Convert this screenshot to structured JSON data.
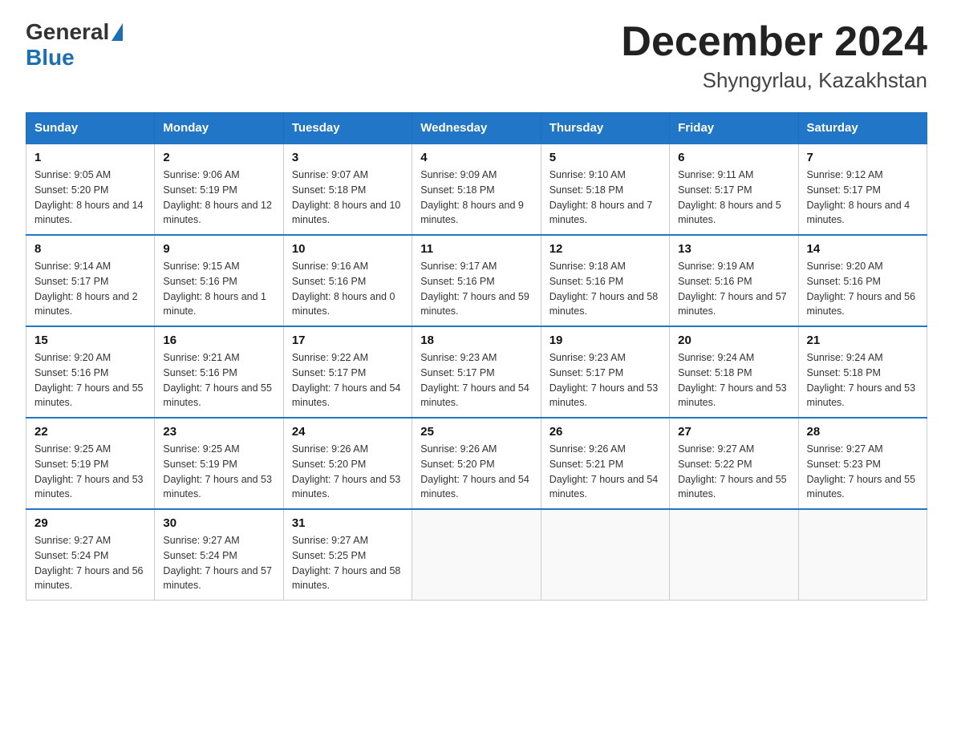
{
  "logo": {
    "general": "General",
    "blue": "Blue"
  },
  "title": "December 2024",
  "subtitle": "Shyngyrlau, Kazakhstan",
  "days_of_week": [
    "Sunday",
    "Monday",
    "Tuesday",
    "Wednesday",
    "Thursday",
    "Friday",
    "Saturday"
  ],
  "weeks": [
    [
      {
        "day": "1",
        "sunrise": "9:05 AM",
        "sunset": "5:20 PM",
        "daylight": "8 hours and 14 minutes."
      },
      {
        "day": "2",
        "sunrise": "9:06 AM",
        "sunset": "5:19 PM",
        "daylight": "8 hours and 12 minutes."
      },
      {
        "day": "3",
        "sunrise": "9:07 AM",
        "sunset": "5:18 PM",
        "daylight": "8 hours and 10 minutes."
      },
      {
        "day": "4",
        "sunrise": "9:09 AM",
        "sunset": "5:18 PM",
        "daylight": "8 hours and 9 minutes."
      },
      {
        "day": "5",
        "sunrise": "9:10 AM",
        "sunset": "5:18 PM",
        "daylight": "8 hours and 7 minutes."
      },
      {
        "day": "6",
        "sunrise": "9:11 AM",
        "sunset": "5:17 PM",
        "daylight": "8 hours and 5 minutes."
      },
      {
        "day": "7",
        "sunrise": "9:12 AM",
        "sunset": "5:17 PM",
        "daylight": "8 hours and 4 minutes."
      }
    ],
    [
      {
        "day": "8",
        "sunrise": "9:14 AM",
        "sunset": "5:17 PM",
        "daylight": "8 hours and 2 minutes."
      },
      {
        "day": "9",
        "sunrise": "9:15 AM",
        "sunset": "5:16 PM",
        "daylight": "8 hours and 1 minute."
      },
      {
        "day": "10",
        "sunrise": "9:16 AM",
        "sunset": "5:16 PM",
        "daylight": "8 hours and 0 minutes."
      },
      {
        "day": "11",
        "sunrise": "9:17 AM",
        "sunset": "5:16 PM",
        "daylight": "7 hours and 59 minutes."
      },
      {
        "day": "12",
        "sunrise": "9:18 AM",
        "sunset": "5:16 PM",
        "daylight": "7 hours and 58 minutes."
      },
      {
        "day": "13",
        "sunrise": "9:19 AM",
        "sunset": "5:16 PM",
        "daylight": "7 hours and 57 minutes."
      },
      {
        "day": "14",
        "sunrise": "9:20 AM",
        "sunset": "5:16 PM",
        "daylight": "7 hours and 56 minutes."
      }
    ],
    [
      {
        "day": "15",
        "sunrise": "9:20 AM",
        "sunset": "5:16 PM",
        "daylight": "7 hours and 55 minutes."
      },
      {
        "day": "16",
        "sunrise": "9:21 AM",
        "sunset": "5:16 PM",
        "daylight": "7 hours and 55 minutes."
      },
      {
        "day": "17",
        "sunrise": "9:22 AM",
        "sunset": "5:17 PM",
        "daylight": "7 hours and 54 minutes."
      },
      {
        "day": "18",
        "sunrise": "9:23 AM",
        "sunset": "5:17 PM",
        "daylight": "7 hours and 54 minutes."
      },
      {
        "day": "19",
        "sunrise": "9:23 AM",
        "sunset": "5:17 PM",
        "daylight": "7 hours and 53 minutes."
      },
      {
        "day": "20",
        "sunrise": "9:24 AM",
        "sunset": "5:18 PM",
        "daylight": "7 hours and 53 minutes."
      },
      {
        "day": "21",
        "sunrise": "9:24 AM",
        "sunset": "5:18 PM",
        "daylight": "7 hours and 53 minutes."
      }
    ],
    [
      {
        "day": "22",
        "sunrise": "9:25 AM",
        "sunset": "5:19 PM",
        "daylight": "7 hours and 53 minutes."
      },
      {
        "day": "23",
        "sunrise": "9:25 AM",
        "sunset": "5:19 PM",
        "daylight": "7 hours and 53 minutes."
      },
      {
        "day": "24",
        "sunrise": "9:26 AM",
        "sunset": "5:20 PM",
        "daylight": "7 hours and 53 minutes."
      },
      {
        "day": "25",
        "sunrise": "9:26 AM",
        "sunset": "5:20 PM",
        "daylight": "7 hours and 54 minutes."
      },
      {
        "day": "26",
        "sunrise": "9:26 AM",
        "sunset": "5:21 PM",
        "daylight": "7 hours and 54 minutes."
      },
      {
        "day": "27",
        "sunrise": "9:27 AM",
        "sunset": "5:22 PM",
        "daylight": "7 hours and 55 minutes."
      },
      {
        "day": "28",
        "sunrise": "9:27 AM",
        "sunset": "5:23 PM",
        "daylight": "7 hours and 55 minutes."
      }
    ],
    [
      {
        "day": "29",
        "sunrise": "9:27 AM",
        "sunset": "5:24 PM",
        "daylight": "7 hours and 56 minutes."
      },
      {
        "day": "30",
        "sunrise": "9:27 AM",
        "sunset": "5:24 PM",
        "daylight": "7 hours and 57 minutes."
      },
      {
        "day": "31",
        "sunrise": "9:27 AM",
        "sunset": "5:25 PM",
        "daylight": "7 hours and 58 minutes."
      },
      null,
      null,
      null,
      null
    ]
  ],
  "labels": {
    "sunrise": "Sunrise:",
    "sunset": "Sunset:",
    "daylight": "Daylight:"
  }
}
